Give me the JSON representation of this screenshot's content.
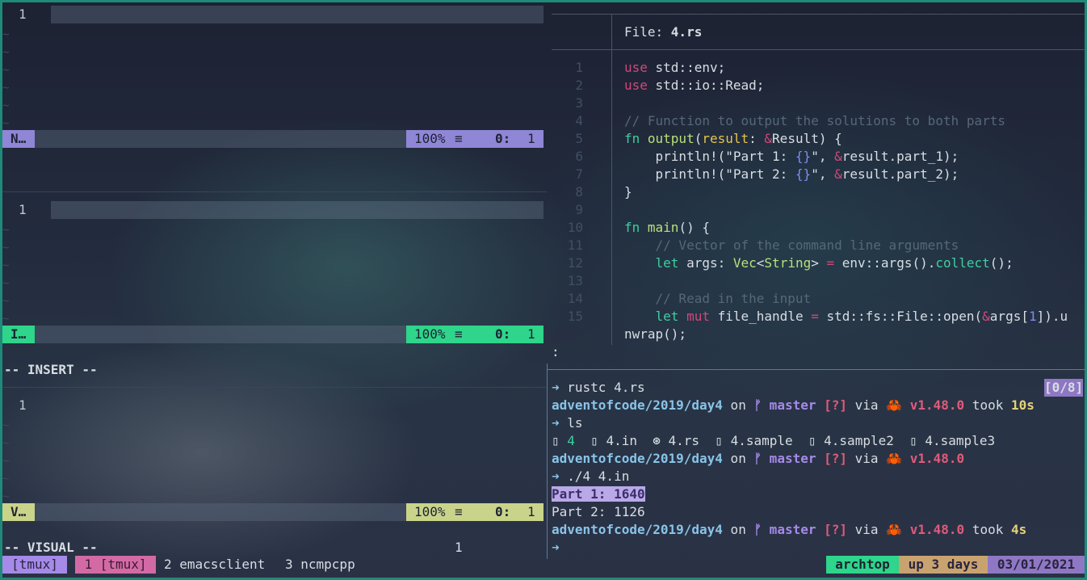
{
  "panes": {
    "top": {
      "line": "1",
      "mode": "N…",
      "mode_color": "#8f86d6",
      "percent": "100%",
      "col": "0:",
      "line_no": "1"
    },
    "middle": {
      "line": "1",
      "mode": "I…",
      "mode_color": "#2ed58a",
      "percent": "100%",
      "col": "0:",
      "line_no": "1",
      "mode_msg": "-- INSERT --"
    },
    "bottom": {
      "line": "1",
      "mode": "V…",
      "mode_color": "#c9d48a",
      "percent": "100%",
      "col": "0:",
      "line_no": "1",
      "mode_msg": "-- VISUAL --",
      "ruler": "1"
    }
  },
  "bat": {
    "file_label": "File: ",
    "file_name": "4.rs",
    "line_numbers": [
      "1",
      "2",
      "3",
      "4",
      "5",
      "6",
      "7",
      "8",
      "9",
      "10",
      "11",
      "12",
      "13",
      "14",
      "15"
    ],
    "lines": [
      [
        [
          "use",
          "kw"
        ],
        [
          " std::env;",
          "st"
        ]
      ],
      [
        [
          "use",
          "kw"
        ],
        [
          " std::io::Read;",
          "st"
        ]
      ],
      [],
      [
        [
          "// Function to output the solutions to both parts",
          "cm"
        ]
      ],
      [
        [
          "fn",
          "fn"
        ],
        [
          " output",
          "gr"
        ],
        [
          "(",
          "st"
        ],
        [
          "result",
          "ty"
        ],
        [
          ": ",
          "st"
        ],
        [
          "&",
          "op"
        ],
        [
          "Result) {",
          "st"
        ]
      ],
      [
        [
          "    println!(\"Part 1: ",
          "st"
        ],
        [
          "{}",
          "pl"
        ],
        [
          "\", ",
          "st"
        ],
        [
          "&",
          "op"
        ],
        [
          "result.part_1);",
          "st"
        ]
      ],
      [
        [
          "    println!(\"Part 2: ",
          "st"
        ],
        [
          "{}",
          "pl"
        ],
        [
          "\", ",
          "st"
        ],
        [
          "&",
          "op"
        ],
        [
          "result.part_2);",
          "st"
        ]
      ],
      [
        [
          "}",
          "st"
        ]
      ],
      [],
      [
        [
          "fn",
          "fn"
        ],
        [
          " main",
          "gr"
        ],
        [
          "() {",
          "st"
        ]
      ],
      [
        [
          "    // Vector of the command line arguments",
          "cm"
        ]
      ],
      [
        [
          "    ",
          "st"
        ],
        [
          "let",
          "fn"
        ],
        [
          " args: ",
          "st"
        ],
        [
          "Vec",
          "gr"
        ],
        [
          "<",
          "st"
        ],
        [
          "String",
          "gr"
        ],
        [
          "> ",
          "st"
        ],
        [
          "=",
          "op"
        ],
        [
          " env::args().",
          "st"
        ],
        [
          "collect",
          "fn"
        ],
        [
          "();",
          "st"
        ]
      ],
      [],
      [
        [
          "    // Read in the input",
          "cm"
        ]
      ],
      [
        [
          "    ",
          "st"
        ],
        [
          "let",
          "fn"
        ],
        [
          " ",
          "st"
        ],
        [
          "mut",
          "kw"
        ],
        [
          " file_handle ",
          "st"
        ],
        [
          "=",
          "op"
        ],
        [
          " std::fs::File::open(",
          "st"
        ],
        [
          "&",
          "op"
        ],
        [
          "args[",
          "st"
        ],
        [
          "1",
          "pl"
        ],
        [
          "]).u",
          "st"
        ]
      ],
      [
        [
          "nwrap();",
          "st"
        ]
      ]
    ],
    "prompt": ":"
  },
  "terminal": {
    "lines": [
      [
        [
          "➜ ",
          "arrow"
        ],
        [
          "rustc 4.rs",
          "st"
        ]
      ],
      [
        [
          "adventofcode/2019/day4",
          "path"
        ],
        [
          " on ",
          "st"
        ],
        [
          "ᚠ master",
          "branch"
        ],
        [
          " ",
          "st"
        ],
        [
          "[?]",
          "red"
        ],
        [
          " via ",
          "st"
        ],
        [
          "🦀 v1.48.0",
          "ver"
        ],
        [
          " took ",
          "st"
        ],
        [
          "10s",
          "dur"
        ]
      ],
      [
        [
          "➜ ",
          "arrow"
        ],
        [
          "ls",
          "st"
        ]
      ],
      [
        [
          "▯ ",
          "st"
        ],
        [
          "4",
          "fn"
        ],
        [
          "  ▯ 4.in  ⊛ 4.rs  ▯ 4.sample  ▯ 4.sample2  ▯ 4.sample3",
          "st"
        ]
      ],
      [
        [
          "adventofcode/2019/day4",
          "path"
        ],
        [
          " on ",
          "st"
        ],
        [
          "ᚠ master",
          "branch"
        ],
        [
          " ",
          "st"
        ],
        [
          "[?]",
          "red"
        ],
        [
          " via ",
          "st"
        ],
        [
          "🦀 v1.48.0",
          "ver"
        ]
      ],
      [
        [
          "➜ ",
          "arrow"
        ],
        [
          "./4 4.in",
          "st"
        ]
      ],
      [
        [
          "Part 1: 1640",
          "sel"
        ]
      ],
      [
        [
          "Part 2: 1126",
          "st"
        ]
      ],
      [
        [
          "adventofcode/2019/day4",
          "path"
        ],
        [
          " on ",
          "st"
        ],
        [
          "ᚠ master",
          "branch"
        ],
        [
          " ",
          "st"
        ],
        [
          "[?]",
          "red"
        ],
        [
          " via ",
          "st"
        ],
        [
          "🦀 v1.48.0",
          "ver"
        ],
        [
          " took ",
          "st"
        ],
        [
          "4s",
          "dur"
        ]
      ],
      [
        [
          "➜",
          "arrow"
        ]
      ]
    ],
    "scroll_indicator": "[0/8]"
  },
  "tmux": {
    "session": "[tmux]",
    "windows": [
      {
        "label": "1 [tmux]",
        "active": true
      },
      {
        "label": "2 emacsclient",
        "active": false
      },
      {
        "label": "3 ncmpcpp",
        "active": false
      }
    ],
    "host": "archtop",
    "uptime": "up 3 days",
    "date": "03/01/2021",
    "colors": {
      "session": "#a58ae8",
      "active_window": "#d36aa6",
      "host": "#2ed58a",
      "uptime": "#c9a36f",
      "date": "#8e78c4"
    }
  }
}
